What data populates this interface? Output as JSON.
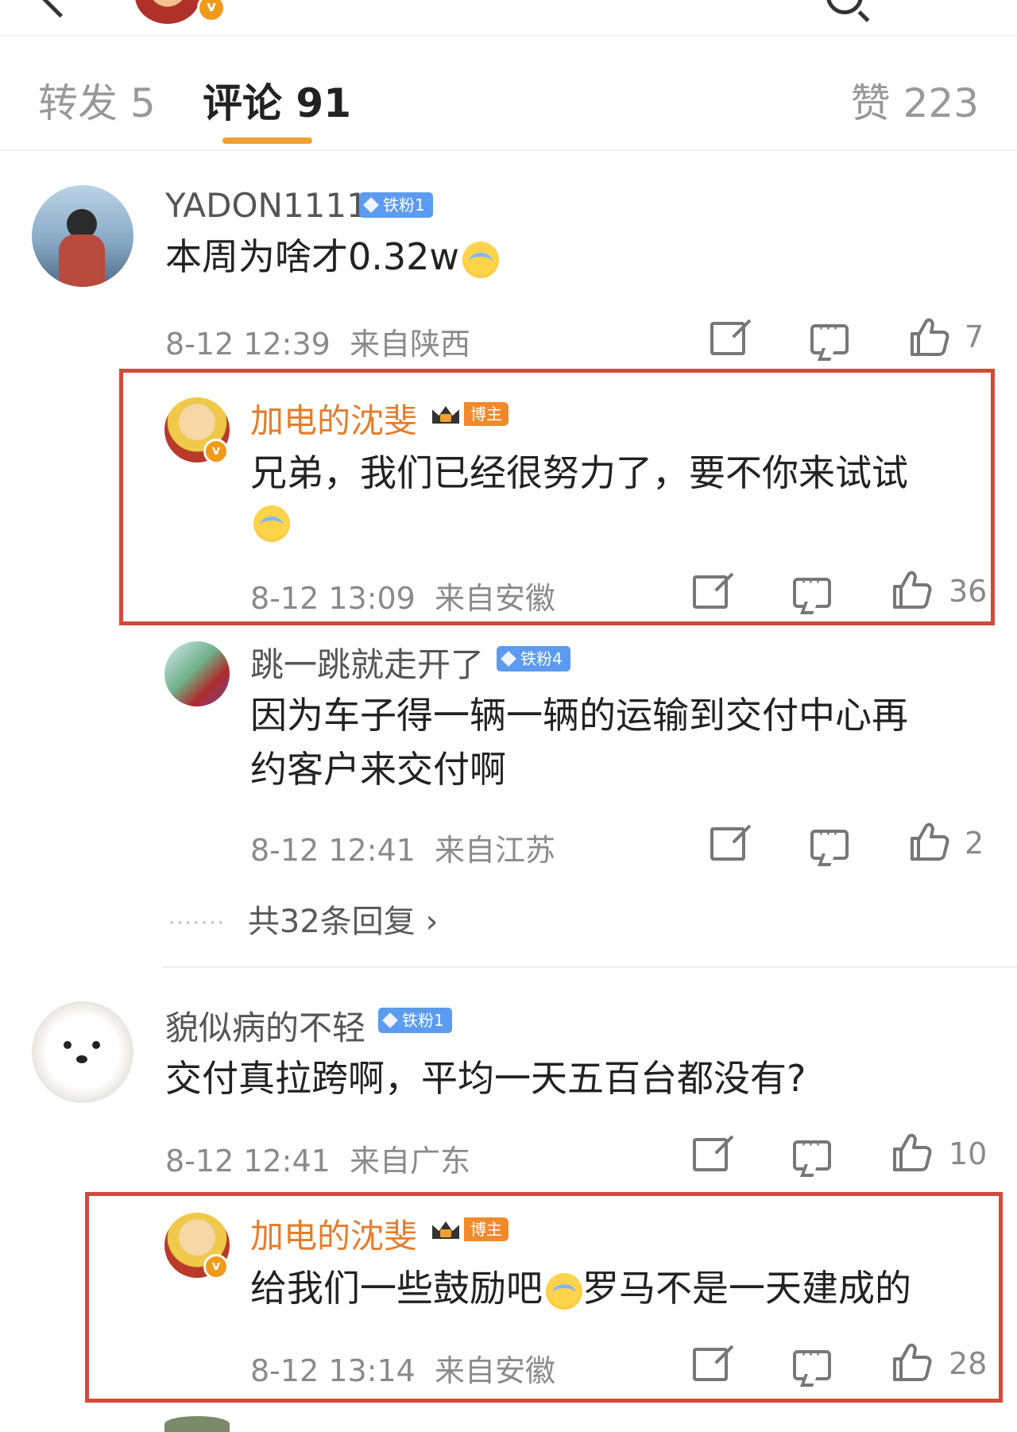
{
  "tabs": {
    "repost_label": "转发 5",
    "comments_label": "评论 91",
    "likes_label": "赞 223"
  },
  "comments": [
    {
      "username": "YADON1111",
      "badge": "铁粉1",
      "text": "本周为啥才0.32w",
      "emoji": "crying-emoji",
      "time": "8-12 12:39",
      "location": "来自陕西",
      "likes": "7"
    },
    {
      "username": "加电的沈斐",
      "badge": "博主",
      "text_line1": "兄弟，我们已经很努力了，要不你来试试",
      "emoji": "laugh-cry-emoji",
      "time": "8-12 13:09",
      "location": "来自安徽",
      "likes": "36"
    },
    {
      "username": "跳一跳就走开了",
      "badge": "铁粉4",
      "text_line1": "因为车子得一辆一辆的运输到交付中心再",
      "text_line2": "约客户来交付啊",
      "time": "8-12 12:41",
      "location": "来自江苏",
      "likes": "2"
    },
    {
      "more_replies": "共32条回复 ›"
    },
    {
      "username": "貌似病的不轻",
      "badge": "铁粉1",
      "text": "交付真拉跨啊，平均一天五百台都没有?",
      "time": "8-12 12:41",
      "location": "来自广东",
      "likes": "10"
    },
    {
      "username": "加电的沈斐",
      "badge": "博主",
      "text_a": "给我们一些鼓励吧",
      "text_b": "罗马不是一天建成的",
      "emoji": "laugh-cry-emoji",
      "time": "8-12 13:14",
      "location": "来自安徽",
      "likes": "28"
    }
  ],
  "colors": {
    "host_name": "#e67d2a",
    "highlight_box": "#d24a3a",
    "tab_underline": "#f0a030",
    "fan_badge": "#5b9bf0"
  }
}
